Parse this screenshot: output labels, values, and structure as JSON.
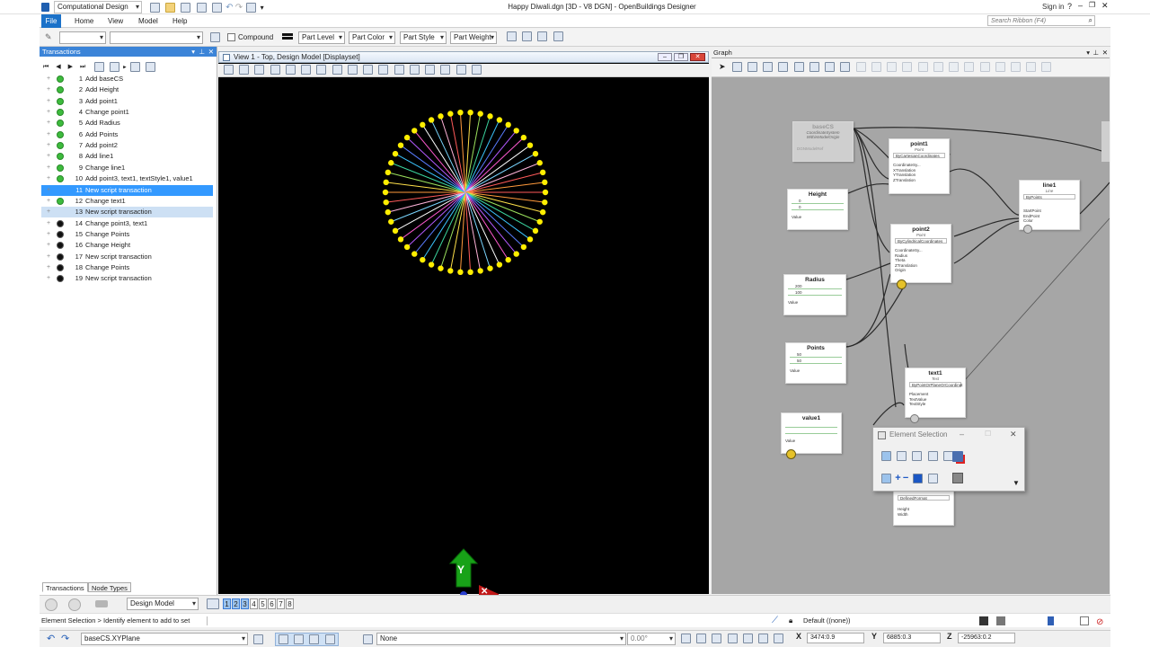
{
  "app": {
    "workflow": "Computational Design",
    "window_title": "Happy Diwali.dgn [3D - V8 DGN] - OpenBuildings Designer",
    "sign_in": "Sign in",
    "search_placeholder": "Search Ribbon (F4)"
  },
  "ribbon": {
    "tabs": [
      "File",
      "Home",
      "View",
      "Model",
      "Help"
    ]
  },
  "toolbar": {
    "compound": "Compound",
    "part_level": "Part Level",
    "part_color": "Part Color",
    "part_style": "Part Style",
    "part_weight": "Part Weight"
  },
  "transactions": {
    "title": "Transactions",
    "rows": [
      {
        "num": "1",
        "label": "Add baseCS",
        "state": "green"
      },
      {
        "num": "2",
        "label": "Add Height",
        "state": "green"
      },
      {
        "num": "3",
        "label": "Add point1",
        "state": "green"
      },
      {
        "num": "4",
        "label": "Change point1",
        "state": "green"
      },
      {
        "num": "5",
        "label": "Add Radius",
        "state": "green"
      },
      {
        "num": "6",
        "label": "Add Points",
        "state": "green"
      },
      {
        "num": "7",
        "label": "Add point2",
        "state": "green"
      },
      {
        "num": "8",
        "label": "Add line1",
        "state": "green"
      },
      {
        "num": "9",
        "label": "Change line1",
        "state": "green"
      },
      {
        "num": "10",
        "label": "Add point3, text1, textStyle1, value1",
        "state": "green"
      },
      {
        "num": "11",
        "label": "New script transaction",
        "state": "selected"
      },
      {
        "num": "12",
        "label": "Change text1",
        "state": "green"
      },
      {
        "num": "13",
        "label": "New script transaction",
        "state": "current"
      },
      {
        "num": "14",
        "label": "Change point3, text1",
        "state": "black"
      },
      {
        "num": "15",
        "label": "Change Points",
        "state": "black"
      },
      {
        "num": "16",
        "label": "Change Height",
        "state": "black"
      },
      {
        "num": "17",
        "label": "New script transaction",
        "state": "black"
      },
      {
        "num": "18",
        "label": "Change Points",
        "state": "black"
      },
      {
        "num": "19",
        "label": "New script transaction",
        "state": "black"
      }
    ],
    "bottom_tabs": [
      "Transactions",
      "Node Types"
    ]
  },
  "view": {
    "title": "View 1 - Top, Design Model [Displayset]",
    "axis_label": "Y"
  },
  "graph": {
    "title": "Graph",
    "nodes": {
      "baseCS": {
        "title": "baseCS",
        "subtitle": "CoordinateSystem",
        "method": "WithinModelOrigin",
        "port": "DGNModelRef"
      },
      "point1": {
        "title": "point1",
        "subtitle": "Point",
        "method": "ByCartesianCoordinates",
        "ports": [
          "CoordinateSy...",
          "XTranslation",
          "YTranslation",
          "ZTranslation"
        ]
      },
      "line1": {
        "title": "line1",
        "subtitle": "Line",
        "method": "ByPoints",
        "ports": [
          "StartPoint",
          "EndPoint",
          "Color"
        ]
      },
      "height": {
        "title": "Height",
        "v1": "0",
        "v2": "0",
        "port": "Value"
      },
      "point2": {
        "title": "point2",
        "subtitle": "Point",
        "method": "ByCylindricalCoordinates",
        "ports": [
          "CoordinateSy...",
          "Radius",
          "Theta",
          "ZTranslation",
          "Origin"
        ]
      },
      "radius": {
        "title": "Radius",
        "v1": "200",
        "v2": "100",
        "port": "Value"
      },
      "points": {
        "title": "Points",
        "v1": "50",
        "v2": "50",
        "port": "Value"
      },
      "text1": {
        "title": "text1",
        "subtitle": "Text",
        "method": "ByPointOrPlaneOrCoordinat",
        "ports": [
          "Placement",
          "TextValue",
          "TextStyle"
        ]
      },
      "value1": {
        "title": "value1",
        "port": "Value"
      },
      "textStyle1": {
        "method": "DefinedFormat",
        "ports": [
          "Height",
          "Width"
        ]
      }
    }
  },
  "element_selection": {
    "title": "Element Selection"
  },
  "view_groups": {
    "model": "Design Model",
    "views": [
      "1",
      "2",
      "3",
      "4",
      "5",
      "6",
      "7",
      "8"
    ]
  },
  "status": {
    "prompt": "Element Selection > Identify element to add to set",
    "level": "Default ((none))"
  },
  "bottom": {
    "plane": "baseCS.XYPlane",
    "none_label": "None",
    "angle": "0.00°",
    "x_label": "X",
    "x_value": "3474:0.9",
    "y_label": "Y",
    "y_value": "6885:0.3",
    "z_label": "Z",
    "z_value": "-25963:0.2"
  },
  "colors": {
    "accent": "#3b84d8",
    "selection": "#3399ff",
    "dot_yellow": "#ffee00",
    "graph_bg": "#a6a6a6"
  }
}
